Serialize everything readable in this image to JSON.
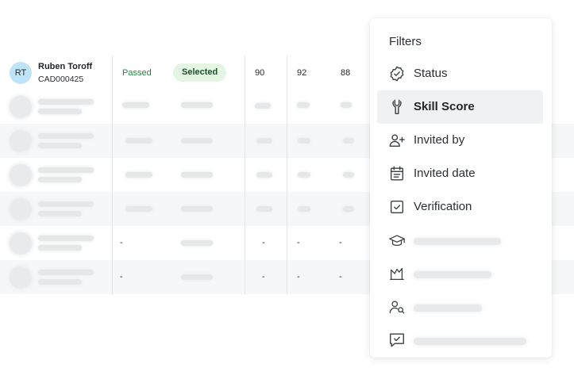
{
  "table": {
    "candidate": {
      "initials": "RT",
      "name": "Ruben Toroff",
      "id": "CAD000425",
      "result": "Passed",
      "status": "Selected",
      "scores": [
        "90",
        "92",
        "88"
      ]
    },
    "placeholder_dash": "-"
  },
  "filters": {
    "title": "Filters",
    "items": [
      {
        "label": "Status",
        "icon": "badge-check-icon"
      },
      {
        "label": "Skill Score",
        "icon": "wrench-icon",
        "active": true
      },
      {
        "label": "Invited by",
        "icon": "user-plus-icon"
      },
      {
        "label": "Invited date",
        "icon": "calendar-icon"
      },
      {
        "label": "Verification",
        "icon": "checkbox-icon"
      },
      {
        "label": "",
        "icon": "graduation-cap-icon"
      },
      {
        "label": "",
        "icon": "chart-icon"
      },
      {
        "label": "",
        "icon": "user-search-icon"
      },
      {
        "label": "",
        "icon": "message-check-icon"
      }
    ]
  }
}
